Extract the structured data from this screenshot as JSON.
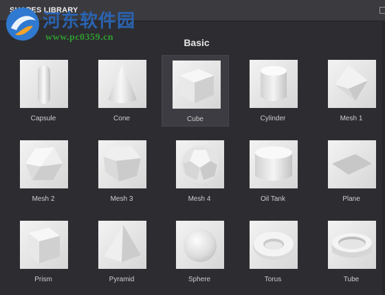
{
  "window": {
    "title": "SHAPES LIBRARY"
  },
  "watermark": {
    "site_name": "河东软件园",
    "url": "www.pc0359.cn"
  },
  "section": {
    "title": "Basic"
  },
  "shapes": [
    {
      "label": "Capsule",
      "icon": "capsule-icon"
    },
    {
      "label": "Cone",
      "icon": "cone-icon"
    },
    {
      "label": "Cube",
      "icon": "cube-icon",
      "selected": true
    },
    {
      "label": "Cylinder",
      "icon": "cylinder-icon"
    },
    {
      "label": "Mesh 1",
      "icon": "mesh-1-icon"
    },
    {
      "label": "Mesh 2",
      "icon": "mesh-2-icon"
    },
    {
      "label": "Mesh 3",
      "icon": "mesh-3-icon"
    },
    {
      "label": "Mesh 4",
      "icon": "mesh-4-icon"
    },
    {
      "label": "Oil Tank",
      "icon": "oil-tank-icon"
    },
    {
      "label": "Plane",
      "icon": "plane-icon"
    },
    {
      "label": "Prism",
      "icon": "prism-icon"
    },
    {
      "label": "Pyramid",
      "icon": "pyramid-icon"
    },
    {
      "label": "Sphere",
      "icon": "sphere-icon"
    },
    {
      "label": "Torus",
      "icon": "torus-icon"
    },
    {
      "label": "Tube",
      "icon": "tube-icon"
    }
  ],
  "colors": {
    "background": "#2d2d31",
    "selected": "#3c3c42",
    "watermark_blue": "#2a66b8",
    "watermark_green": "#2e9a2e"
  }
}
